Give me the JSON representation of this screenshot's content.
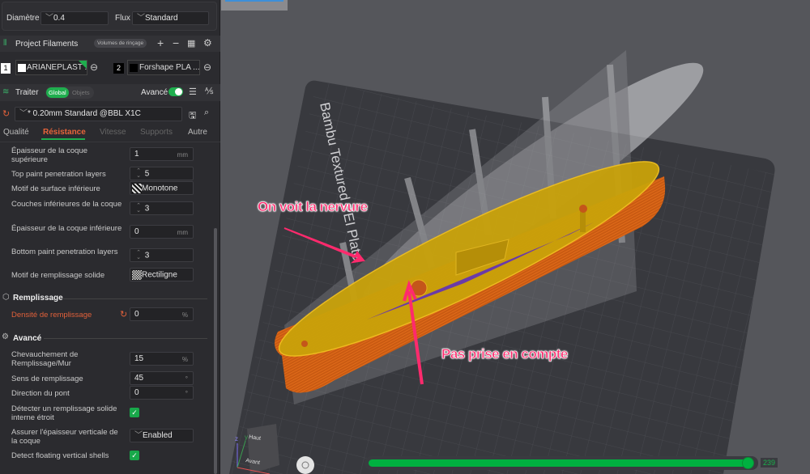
{
  "nozzle": {
    "diameter_label": "Diamètre",
    "diameter_value": "0.4",
    "flow_label": "Flux",
    "flow_value": "Standard"
  },
  "filaments": {
    "title": "Project Filaments",
    "flush_button": "Volumes de rinçage",
    "items": [
      {
        "index": "1",
        "name": "ARIANEPLAST ...",
        "color": "#ffffff"
      },
      {
        "index": "2",
        "name": "Forshape PLA ...",
        "color": "#000000"
      }
    ]
  },
  "process": {
    "title": "Traiter",
    "toggle_global": "Global",
    "toggle_objects": "Objets",
    "advanced_label": "Avancé",
    "advanced_on": true,
    "preset": "* 0.20mm Standard @BBL X1C",
    "tabs": [
      "Qualité",
      "Résistance",
      "Vitesse",
      "Supports",
      "Autre"
    ],
    "active_tab": "Résistance"
  },
  "settings": {
    "shell": [
      {
        "label": "Épaisseur de la coque supérieure",
        "value": "1",
        "unit": "mm"
      },
      {
        "label": "Top paint penetration layers",
        "value": "5"
      },
      {
        "label": "Motif de surface inférieure",
        "value": "Monotone"
      },
      {
        "label": "Couches inférieures de la coque",
        "value": "3"
      },
      {
        "label": "Épaisseur de la coque inférieure",
        "value": "0",
        "unit": "mm"
      },
      {
        "label": "Bottom paint penetration layers",
        "value": "3"
      },
      {
        "label": "Motif de remplissage solide",
        "value": "Rectiligne"
      }
    ],
    "infill_section": "Remplissage",
    "infill": {
      "label": "Densité de remplissage",
      "value": "0",
      "unit": "%"
    },
    "advanced_section": "Avancé",
    "advanced": [
      {
        "label": "Chevauchement de Remplissage/Mur",
        "value": "15",
        "unit": "%"
      },
      {
        "label": "Sens de remplissage",
        "value": "45",
        "unit": "°"
      },
      {
        "label": "Direction du pont",
        "value": "0",
        "unit": "°"
      },
      {
        "label": "Détecter un remplissage solide interne étroit",
        "checked": true
      },
      {
        "label": "Assurer l'épaisseur verticale de la coque",
        "value": "Enabled"
      },
      {
        "label": "Detect floating vertical shells",
        "checked": true
      }
    ]
  },
  "viewport": {
    "bed_label": "Bambu Textured PEI Plate",
    "annotation_1": "On voit la nervure",
    "annotation_2": "Pas prise en compte",
    "axis_top": "Haut",
    "axis_front": "Avant",
    "axis_z": "z",
    "axis_y": "y",
    "layer_value": "239",
    "layer_fraction": 1.0
  },
  "colors": {
    "accent": "#00b140",
    "highlight": "#ff6a3d",
    "annotation": "#ff2a6d"
  }
}
